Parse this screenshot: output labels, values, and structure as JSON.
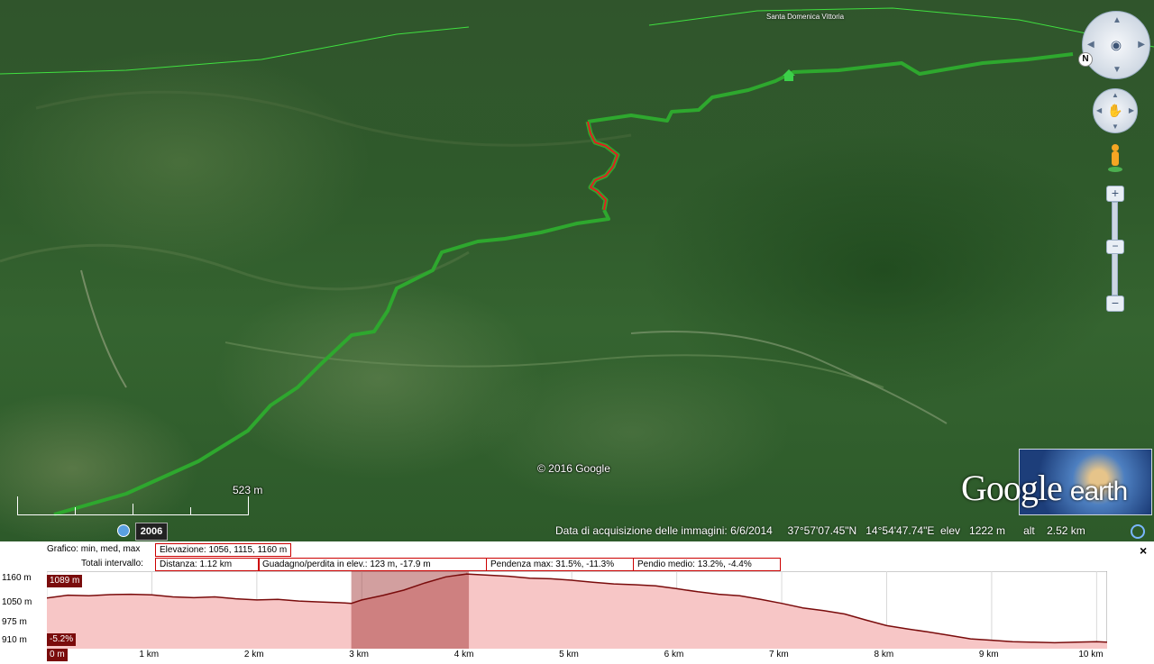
{
  "map": {
    "place_label": "Santa Domenica Vittoria",
    "copyright": "© 2016 Google",
    "scale_label": "523 m",
    "historical_year": "2006",
    "status": {
      "acquisition": "Data di acquisizione delle immagini: 6/6/2014",
      "lat": "37°57'07.45\"N",
      "lon": "14°54'47.74\"E",
      "elev_label": "elev",
      "elev_value": "1222 m",
      "alt_label": "alt",
      "alt_value": "2.52 km"
    },
    "logo": {
      "google": "Google",
      "earth": "earth"
    },
    "north_label": "N"
  },
  "controls": {
    "look_icon": "eye-icon",
    "move_icon": "hand-icon",
    "zoom_in": "+",
    "zoom_out": "−",
    "zoom_thumb": "−"
  },
  "profile": {
    "row1_label": "Grafico: min, med, max",
    "elevation": "Elevazione: 1056, 1115, 1160 m",
    "row2_label": "Totali intervallo:",
    "distance": "Distanza: 1.12 km",
    "gain_loss": "Guadagno/perdita in elev.: 123 m, -17.9 m",
    "max_slope": "Pendenza max: 31.5%, -11.3%",
    "avg_slope": "Pendio medio: 13.2%, -4.4%",
    "close": "×",
    "cursor_elev": "1089 m",
    "cursor_slope": "-5.2%",
    "cursor_dist": "0 m"
  },
  "chart_data": {
    "type": "area",
    "xlabel": "",
    "ylabel": "",
    "y_ticks": [
      "1160 m",
      "1050 m",
      "975 m",
      "910 m"
    ],
    "x_ticks": [
      "0 m",
      "1 km",
      "2 km",
      "3 km",
      "4 km",
      "5 km",
      "6 km",
      "7 km",
      "8 km",
      "9 km",
      "10 km"
    ],
    "xlim": [
      0,
      10.1
    ],
    "ylim": [
      895,
      1170
    ],
    "selected_range_km": [
      2.9,
      4.02
    ],
    "x": [
      0,
      0.2,
      0.4,
      0.6,
      0.8,
      1.0,
      1.2,
      1.4,
      1.6,
      1.8,
      2.0,
      2.2,
      2.4,
      2.6,
      2.8,
      2.9,
      3.0,
      3.2,
      3.4,
      3.6,
      3.8,
      4.0,
      4.2,
      4.4,
      4.6,
      4.8,
      5.0,
      5.2,
      5.4,
      5.6,
      5.8,
      6.0,
      6.2,
      6.4,
      6.6,
      6.8,
      7.0,
      7.2,
      7.4,
      7.6,
      7.8,
      8.0,
      8.2,
      8.4,
      8.6,
      8.8,
      9.0,
      9.2,
      9.4,
      9.6,
      9.8,
      10.0,
      10.1
    ],
    "y": [
      1075,
      1085,
      1083,
      1087,
      1088,
      1086,
      1079,
      1076,
      1079,
      1072,
      1068,
      1070,
      1064,
      1061,
      1058,
      1056,
      1068,
      1084,
      1103,
      1128,
      1150,
      1160,
      1156,
      1152,
      1145,
      1143,
      1138,
      1131,
      1125,
      1122,
      1118,
      1108,
      1097,
      1088,
      1083,
      1070,
      1056,
      1040,
      1030,
      1018,
      997,
      977,
      965,
      954,
      942,
      930,
      925,
      920,
      918,
      916,
      918,
      920,
      918
    ]
  }
}
